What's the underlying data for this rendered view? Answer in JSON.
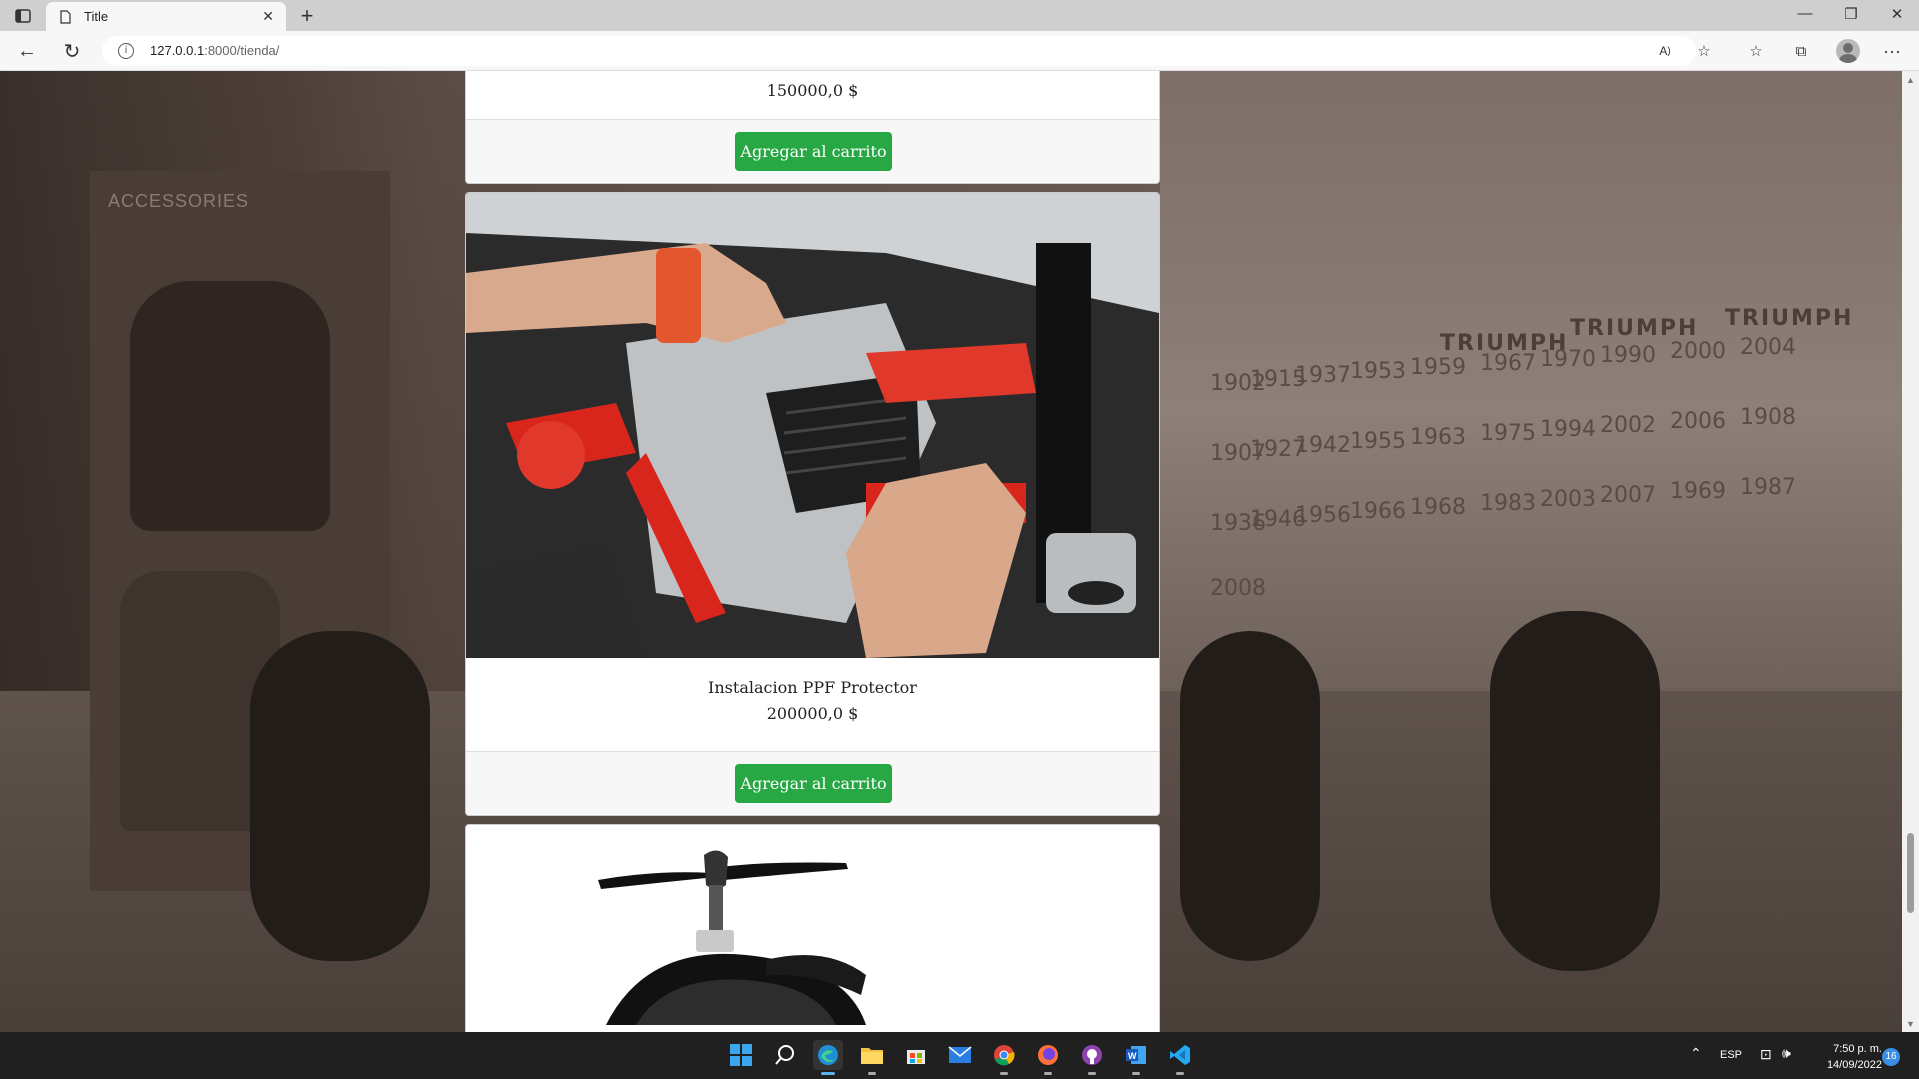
{
  "browser": {
    "tab_title": "Title",
    "url_host": "127.0.0.1",
    "url_rest": ":8000/tienda/"
  },
  "products": [
    {
      "name": "",
      "price": "150000,0 $",
      "button": "Agregar al carrito"
    },
    {
      "name": "Instalacion PPF Protector",
      "price": "200000,0 $",
      "button": "Agregar al carrito"
    },
    {
      "name": "",
      "price": "",
      "button": ""
    }
  ],
  "background": {
    "sign": "ACCESSORIES",
    "brand": "TRIUMPH",
    "years": [
      "1902",
      "1915",
      "1937",
      "1953",
      "1959",
      "1967",
      "1970",
      "1990",
      "2000",
      "2004",
      "1907",
      "1927",
      "1942",
      "1955",
      "1963",
      "1975",
      "1994",
      "2002",
      "2006",
      "1908",
      "1936",
      "1946",
      "1956",
      "1966",
      "1968",
      "1983",
      "2003",
      "2007",
      "1969",
      "1987",
      "2008"
    ]
  },
  "taskbar": {
    "language": "ESP",
    "time": "7:50 p. m.",
    "date": "14/09/2022",
    "notifications": "16"
  }
}
